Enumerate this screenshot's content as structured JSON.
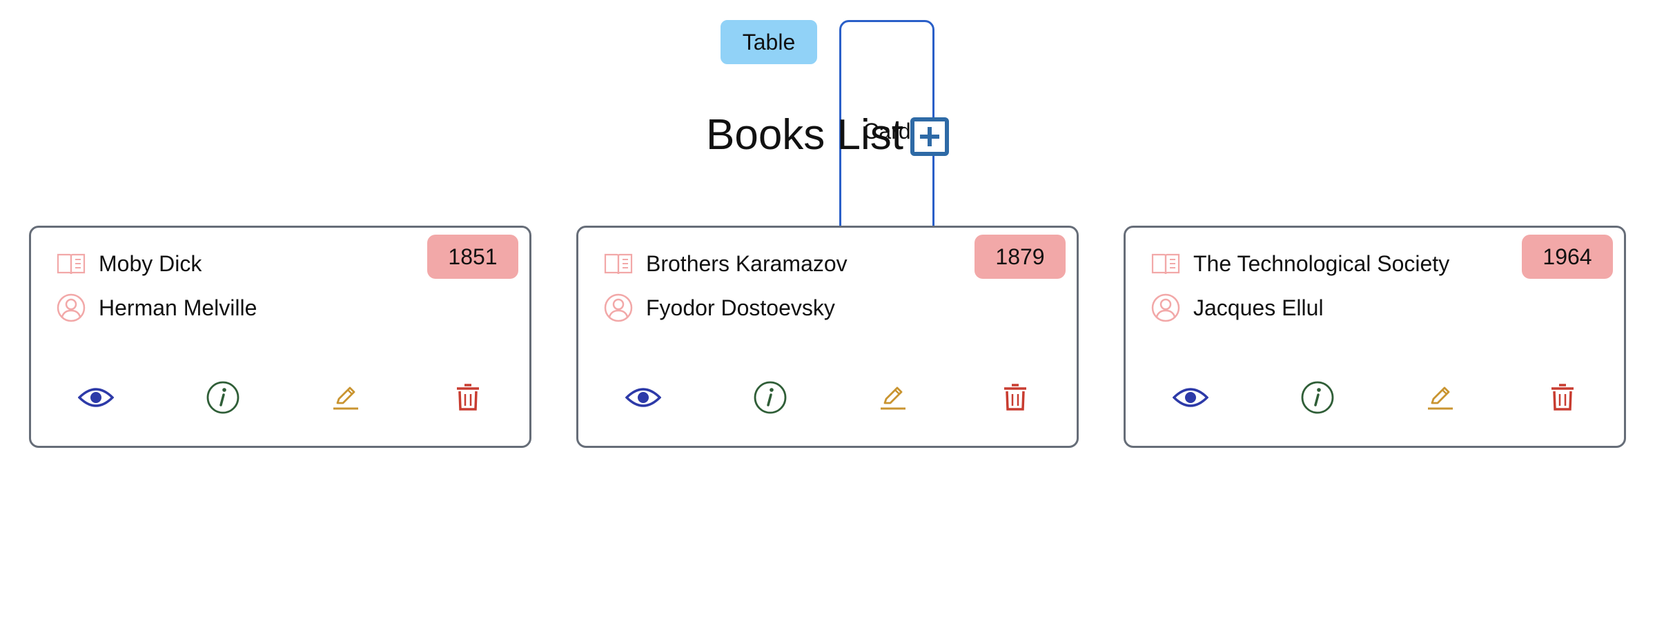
{
  "view_toggle": {
    "table_label": "Table",
    "card_label": "Card",
    "selected": "Card"
  },
  "page": {
    "title": "Books List",
    "add_icon": "plus-square-icon"
  },
  "colors": {
    "toggle_bg": "#91d2f7",
    "toggle_selected_border": "#2a5fc8",
    "badge_bg": "#f2a8a8",
    "meta_icon": "#f2a8a8",
    "view_icon": "#2d3aa8",
    "info_icon": "#2f5e37",
    "edit_icon": "#c99430",
    "delete_icon": "#c83c30",
    "add_icon": "#2e6aa6",
    "card_border": "#666d78"
  },
  "card_actions": [
    "eye-icon",
    "info-icon",
    "pencil-icon",
    "trash-icon"
  ],
  "books": [
    {
      "title": "Moby Dick",
      "author": "Herman Melville",
      "year": "1851"
    },
    {
      "title": "Brothers Karamazov",
      "author": "Fyodor Dostoevsky",
      "year": "1879"
    },
    {
      "title": "The Technological Society",
      "author": "Jacques Ellul",
      "year": "1964"
    }
  ]
}
